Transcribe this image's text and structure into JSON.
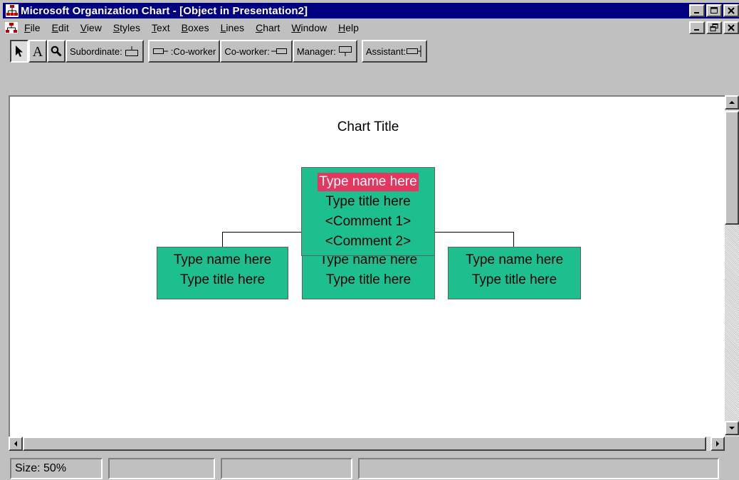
{
  "window": {
    "title": "Microsoft Organization Chart - [Object in Presentation2]"
  },
  "menu": {
    "items": [
      {
        "u": "F",
        "rest": "ile"
      },
      {
        "u": "E",
        "rest": "dit"
      },
      {
        "u": "V",
        "rest": "iew"
      },
      {
        "u": "S",
        "rest": "tyles"
      },
      {
        "u": "T",
        "rest": "ext"
      },
      {
        "u": "B",
        "rest": "oxes"
      },
      {
        "u": "L",
        "rest": "ines"
      },
      {
        "u": "C",
        "rest": "hart"
      },
      {
        "u": "W",
        "rest": "indow"
      },
      {
        "u": "H",
        "rest": "elp"
      }
    ]
  },
  "toolbar": {
    "subordinate": "Subordinate:",
    "coworker_left": ":Co-worker",
    "coworker_right": "Co-worker:",
    "manager": "Manager:",
    "assistant": "Assistant:"
  },
  "chart": {
    "title": "Chart Title",
    "manager": {
      "name": "Type name here",
      "title": "Type title here",
      "comment1": "<Comment 1>",
      "comment2": "<Comment 2>"
    },
    "subordinates": [
      {
        "name": "Type name here",
        "title": "Type title here"
      },
      {
        "name": "Type name here",
        "title": "Type title here"
      },
      {
        "name": "Type name here",
        "title": "Type title here"
      }
    ]
  },
  "status": {
    "size": "Size: 50%"
  },
  "colors": {
    "titlebar": "#000080",
    "box_fill": "#1dbf8e",
    "selection": "#e4365f"
  }
}
